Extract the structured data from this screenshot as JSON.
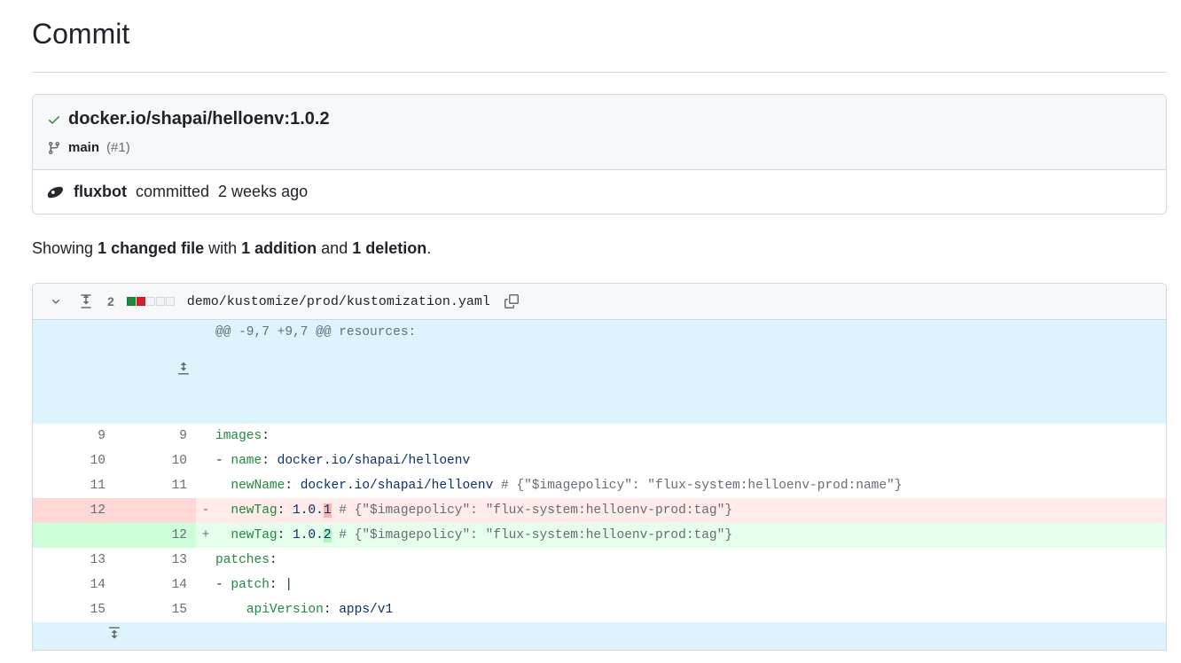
{
  "page_title": "Commit",
  "commit": {
    "check_status": "success",
    "title": "docker.io/shapai/helloenv:1.0.2",
    "branch": "main",
    "pr_ref": "(#1)",
    "author": "fluxbot",
    "committed_word": "committed",
    "time": "2 weeks ago"
  },
  "summary": {
    "prefix": "Showing",
    "files": "1 changed file",
    "with_word": "with",
    "additions": "1 addition",
    "and_word": "and",
    "deletions": "1 deletion",
    "suffix": "."
  },
  "file": {
    "changes_count": "2",
    "path": "demo/kustomize/prod/kustomization.yaml",
    "hunk_header": "@@ -9,7 +9,7 @@ resources:"
  },
  "diff": {
    "lines": [
      {
        "old": "9",
        "new": "9",
        "marker": " ",
        "text": "images:"
      },
      {
        "old": "10",
        "new": "10",
        "marker": " ",
        "text": "- name: docker.io/shapai/helloenv"
      },
      {
        "old": "11",
        "new": "11",
        "marker": " ",
        "text": "  newName: docker.io/shapai/helloenv # {\"$imagepolicy\": \"flux-system:helloenv-prod:name\"}"
      },
      {
        "old": "12",
        "new": "",
        "marker": "-",
        "text": "  newTag: 1.0.1 # {\"$imagepolicy\": \"flux-system:helloenv-prod:tag\"}",
        "highlight": "1"
      },
      {
        "old": "",
        "new": "12",
        "marker": "+",
        "text": "  newTag: 1.0.2 # {\"$imagepolicy\": \"flux-system:helloenv-prod:tag\"}",
        "highlight": "2"
      },
      {
        "old": "13",
        "new": "13",
        "marker": " ",
        "text": "patches:"
      },
      {
        "old": "14",
        "new": "14",
        "marker": " ",
        "text": "- patch: |"
      },
      {
        "old": "15",
        "new": "15",
        "marker": " ",
        "text": "    apiVersion: apps/v1"
      }
    ]
  }
}
